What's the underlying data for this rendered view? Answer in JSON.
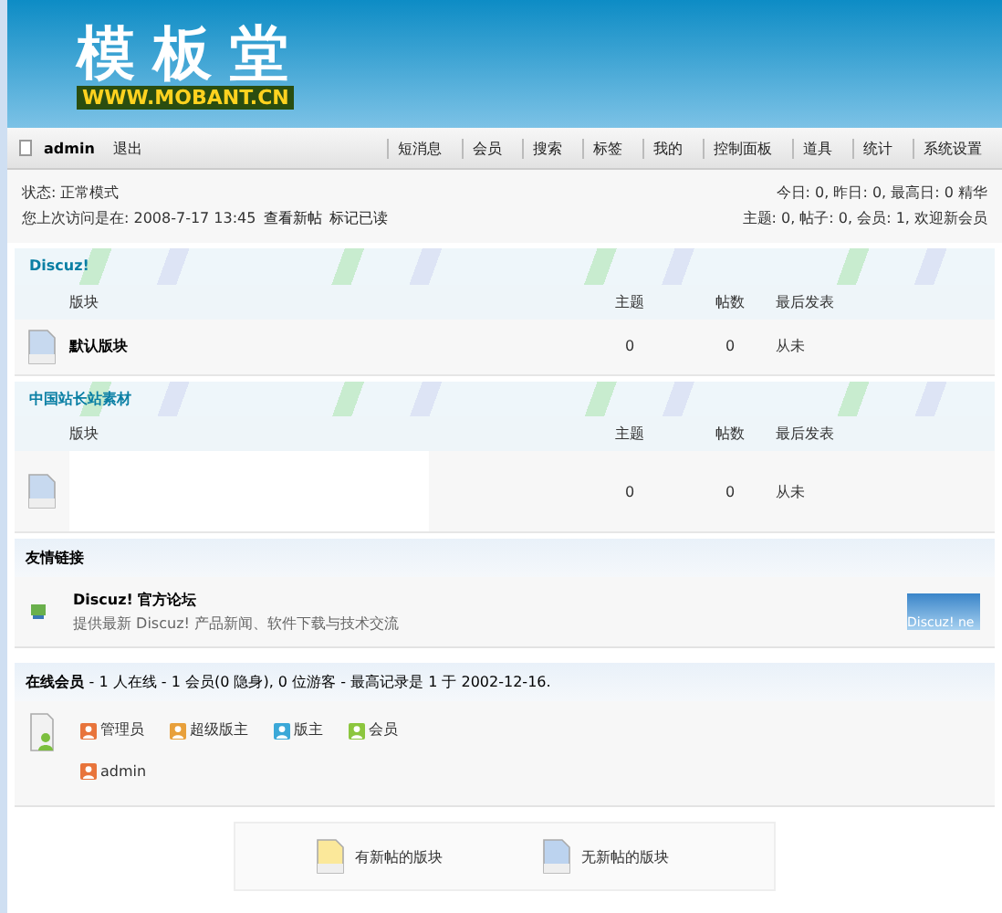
{
  "logo": {
    "title": "模板堂",
    "url": "WWW.MOBANT.CN"
  },
  "userbar": {
    "username": "admin",
    "logout": "退出",
    "nav": [
      "短消息",
      "会员",
      "搜索",
      "标签",
      "我的",
      "控制面板",
      "道具",
      "统计",
      "系统设置"
    ]
  },
  "status": {
    "mode": "状态: 正常模式",
    "last_visit": "您上次访问是在: 2008-7-17 13:45",
    "links": [
      "查看新帖",
      "标记已读"
    ],
    "stats_line1": "今日: 0, 昨日: 0, 最高日: 0  精华",
    "stats_line2": "主题: 0, 帖子: 0, 会员: 1, 欢迎新会员"
  },
  "categories": [
    {
      "title": "Discuz!",
      "columns": [
        "版块",
        "主题",
        "帖数",
        "最后发表"
      ],
      "forums": [
        {
          "name": "默认版块",
          "threads": "0",
          "posts": "0",
          "last_post": "从未",
          "blank": false
        }
      ]
    },
    {
      "title": "中国站长站素材",
      "columns": [
        "版块",
        "主题",
        "帖数",
        "最后发表"
      ],
      "forums": [
        {
          "threads": "0",
          "posts": "0",
          "last_post": "从未",
          "blank": true
        }
      ]
    }
  ],
  "friend_links": {
    "title": "友情链接",
    "items": [
      {
        "name": "Discuz! 官方论坛",
        "description": "提供最新 Discuz! 产品新闻、软件下载与技术交流",
        "banner": "Discuz! ne"
      }
    ]
  },
  "online": {
    "title": "在线会员",
    "summary": "- 1 人在线  - 1 会员(0 隐身), 0 位游客  - 最高记录是 1 于  2002-12-16.",
    "legend": [
      {
        "label": "管理员",
        "color": "#e8743b"
      },
      {
        "label": "超级版主",
        "color": "#e8a03b"
      },
      {
        "label": "版主",
        "color": "#3ba8d8"
      },
      {
        "label": "会员",
        "color": "#8cc63e"
      }
    ],
    "users": [
      {
        "name": "admin",
        "color": "#e8743b"
      }
    ]
  },
  "legend": [
    {
      "label": "有新帖的版块",
      "kind": "new"
    },
    {
      "label": "无新帖的版块",
      "kind": "old"
    }
  ]
}
